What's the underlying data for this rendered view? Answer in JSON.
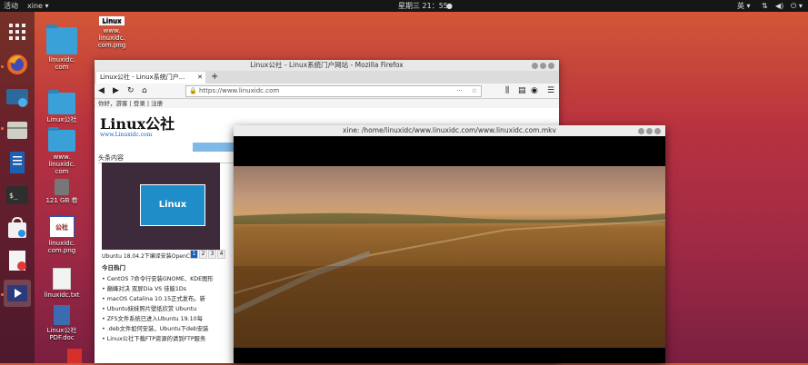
{
  "topbar": {
    "activities": "活动",
    "app_name": "xine",
    "clock": "星期三 21：55",
    "lang": "英"
  },
  "desktop": {
    "icons": [
      {
        "label": "www.\nlinuxidc.\ncom.png",
        "name": "desktop-icon-www-linuxidc-png"
      },
      {
        "label": "linuxidc.\ncom",
        "name": "desktop-icon-linuxidc-com"
      },
      {
        "label": "Linux公社",
        "name": "desktop-icon-linux-gongshe"
      },
      {
        "label": "www.\nlinuxidc.\ncom",
        "name": "desktop-icon-www-linuxidc-com"
      },
      {
        "label": "121 GB 卷",
        "name": "desktop-icon-volume"
      },
      {
        "label": "linuxidc.\ncom.png",
        "name": "desktop-icon-linuxidc-png"
      },
      {
        "label": "linuxidc.txt",
        "name": "desktop-icon-linuxidc-txt"
      },
      {
        "label": "Linux公社\nPDF.doc",
        "name": "desktop-icon-pdf-doc"
      }
    ]
  },
  "firefox": {
    "title": "Linux公社 - Linux系统门户网站 - Mozilla Firefox",
    "tab_label": "Linux公社 - Linux系统门户...",
    "url": "https://www.linuxidc.com",
    "top_links": "你好，游客  |  登录  |  注册",
    "logo_text": "Linux公社",
    "logo_url": "www.Linuxidc.com",
    "nav_strip": "首页",
    "section_head": "头条内容",
    "thumb_caption": "Ubuntu 18.04.2下编译安装OpenCV...",
    "pager": [
      "1",
      "2",
      "3",
      "4"
    ],
    "hot_title": "今日热门",
    "hot_items": [
      "• CentOS 7命令行安装GNOME、KDE图形",
      "• 巅峰对决 双屏Dia VS 佳能1Ds",
      "• macOS Catalina 10.15正式发布。新",
      "• Ubuntu妹妹照片壁纸欣赏 Ubuntu",
      "• ZFS文件系统已进入Ubuntu 19.10每",
      "• .deb文件如何安装，Ubuntu下deb安装",
      "• Linux公社下载FTP资源的请到FTP服务"
    ]
  },
  "xine": {
    "title": "xine: /home/linuxidc/www.linuxidc.com/www.linuxidc.com.mkv"
  },
  "colors": {
    "desktop_top": "#d65a36",
    "desktop_bottom": "#7a1f40",
    "nav_strip": "#7fb9e6"
  }
}
